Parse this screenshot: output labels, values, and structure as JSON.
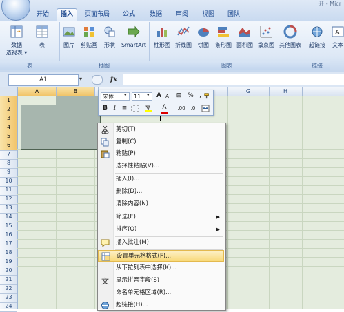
{
  "window": {
    "title_fragment": "开 - Micr"
  },
  "tabs": [
    {
      "label": "开始"
    },
    {
      "label": "插入"
    },
    {
      "label": "页面布局"
    },
    {
      "label": "公式"
    },
    {
      "label": "数据"
    },
    {
      "label": "审阅"
    },
    {
      "label": "视图"
    },
    {
      "label": "团队"
    }
  ],
  "active_tab": "插入",
  "ribbon": {
    "groups": [
      {
        "label": "表",
        "buttons": [
          {
            "label": "数据\n透视表 ▾",
            "icon": "pivot-table-icon"
          },
          {
            "label": "表",
            "icon": "table-icon"
          }
        ]
      },
      {
        "label": "插图",
        "buttons": [
          {
            "label": "图片",
            "icon": "picture-icon"
          },
          {
            "label": "剪贴画",
            "icon": "clipart-icon"
          },
          {
            "label": "形状",
            "icon": "shapes-icon"
          },
          {
            "label": "SmartArt",
            "icon": "smartart-icon"
          }
        ]
      },
      {
        "label": "图表",
        "buttons": [
          {
            "label": "柱形图",
            "icon": "column-chart-icon"
          },
          {
            "label": "折线图",
            "icon": "line-chart-icon"
          },
          {
            "label": "饼图",
            "icon": "pie-chart-icon"
          },
          {
            "label": "条形图",
            "icon": "bar-chart-icon"
          },
          {
            "label": "面积图",
            "icon": "area-chart-icon"
          },
          {
            "label": "散点图",
            "icon": "scatter-chart-icon"
          },
          {
            "label": "其他图表",
            "icon": "other-chart-icon"
          }
        ]
      },
      {
        "label": "链接",
        "buttons": [
          {
            "label": "超链接",
            "icon": "hyperlink-icon"
          }
        ]
      },
      {
        "label": "",
        "buttons": [
          {
            "label": "文本",
            "icon": "textbox-icon"
          }
        ]
      }
    ]
  },
  "formula_bar": {
    "name_box": "A1",
    "fx": "fx",
    "value": ""
  },
  "columns": [
    "A",
    "B",
    "C",
    "D",
    "E",
    "F",
    "G",
    "H",
    "I"
  ],
  "rows": [
    "1",
    "2",
    "3",
    "4",
    "5",
    "6",
    "7",
    "8",
    "9",
    "10",
    "11",
    "12",
    "13",
    "14",
    "15",
    "16",
    "17",
    "18",
    "19",
    "20",
    "21",
    "22",
    "23",
    "24"
  ],
  "mini_toolbar": {
    "font": "宋体",
    "size": "11",
    "grow_font": "A",
    "shrink_font": "A",
    "currency": "⊞",
    "percent": "%",
    "comma": ",",
    "bold": "B",
    "italic": "I",
    "align": "≡",
    "font_color": "A",
    "inc_decimal": ".00",
    "dec_decimal": ".0"
  },
  "context_menu": [
    {
      "label": "剪切(T)",
      "icon": "scissors-icon"
    },
    {
      "label": "复制(C)",
      "icon": "copy-icon"
    },
    {
      "label": "粘贴(P)",
      "icon": "paste-icon"
    },
    {
      "label": "选择性粘贴(V)...",
      "icon": ""
    },
    {
      "label": "插入(I)...",
      "icon": ""
    },
    {
      "label": "删除(D)...",
      "icon": ""
    },
    {
      "label": "清除内容(N)",
      "icon": ""
    },
    {
      "label": "筛选(E)",
      "icon": "",
      "submenu": true
    },
    {
      "label": "排序(O)",
      "icon": "",
      "submenu": true
    },
    {
      "label": "插入批注(M)",
      "icon": "comment-icon"
    },
    {
      "label": "设置单元格格式(F)...",
      "icon": "format-cells-icon",
      "highlighted": true
    },
    {
      "label": "从下拉列表中选择(K)...",
      "icon": ""
    },
    {
      "label": "显示拼音字段(S)",
      "icon": "phonetic-icon"
    },
    {
      "label": "命名单元格区域(R)...",
      "icon": ""
    },
    {
      "label": "超链接(H)...",
      "icon": "hyperlink-icon"
    }
  ],
  "colors": {
    "ribbon_blue": "#dde8f6",
    "selection_fill": "#a7b6ae",
    "grid_bg": "#e4ecde",
    "menu_highlight": "#f8d979"
  }
}
